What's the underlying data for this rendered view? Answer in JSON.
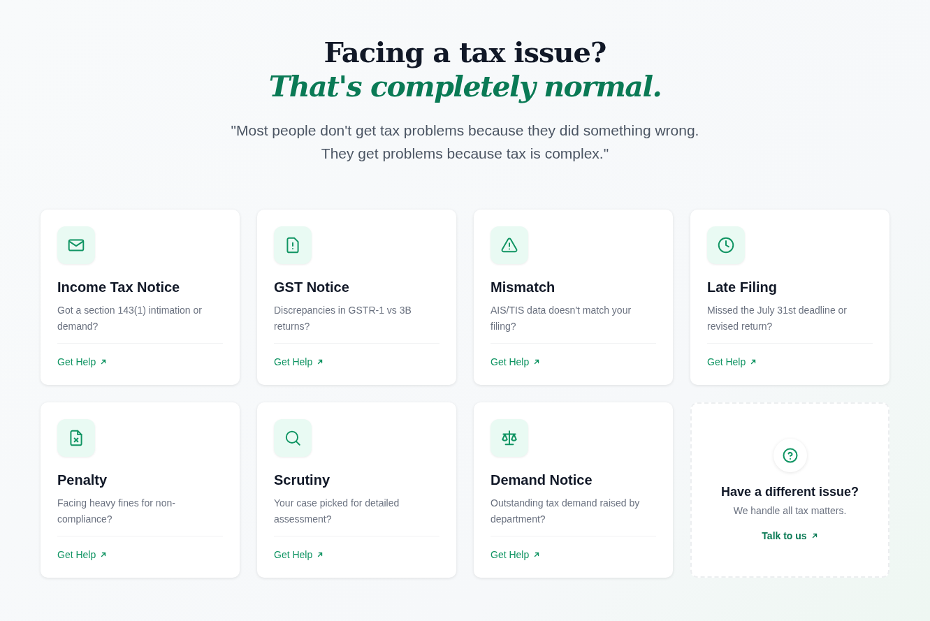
{
  "hero": {
    "title": "Facing a tax issue?",
    "subtitle": "That's completely normal.",
    "quote_lines": [
      "\"Most people don't get tax problems because they did something wrong.",
      "They get problems because tax is complex.\""
    ]
  },
  "issues": [
    {
      "kind": "mail",
      "title": "Income Tax Notice",
      "description": "Got a section 143(1) intimation or demand?",
      "link": "Get Help"
    },
    {
      "kind": "file-alert",
      "title": "GST Notice",
      "description": "Discrepancies in GSTR-1 vs 3B returns?",
      "link": "Get Help"
    },
    {
      "kind": "warning",
      "title": "Mismatch",
      "description": "AIS/TIS data doesn't match your filing?",
      "link": "Get Help"
    },
    {
      "kind": "clock",
      "title": "Late Filing",
      "description": "Missed the July 31st deadline or revised return?",
      "link": "Get Help"
    },
    {
      "kind": "file-x",
      "title": "Penalty",
      "description": "Facing heavy fines for non-compliance?",
      "link": "Get Help"
    },
    {
      "kind": "search",
      "title": "Scrutiny",
      "description": "Your case picked for detailed assessment?",
      "link": "Get Help"
    },
    {
      "kind": "scale",
      "title": "Demand Notice",
      "description": "Outstanding tax demand raised by department?",
      "link": "Get Help"
    }
  ],
  "other": {
    "title": "Have a different issue?",
    "description": "We handle all tax matters.",
    "link": "Talk to us"
  }
}
